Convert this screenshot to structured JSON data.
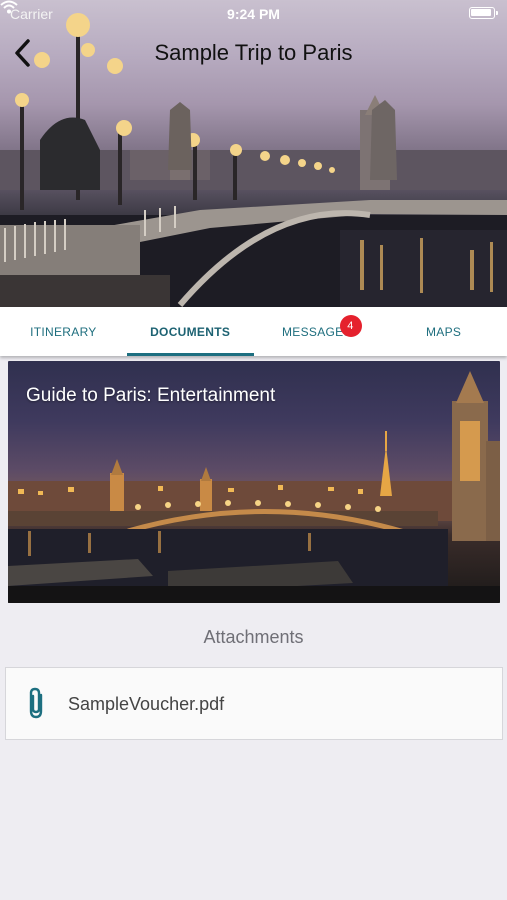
{
  "status_bar": {
    "carrier": "Carrier",
    "time": "9:24 PM"
  },
  "header": {
    "title": "Sample Trip to Paris",
    "back_icon": "chevron-left-icon"
  },
  "tabs": [
    {
      "label": "ITINERARY",
      "active": false
    },
    {
      "label": "DOCUMENTS",
      "active": true
    },
    {
      "label": "MESSAGES",
      "active": false,
      "badge": "4"
    },
    {
      "label": "MAPS",
      "active": false
    }
  ],
  "document": {
    "title": "Guide to Paris: Entertainment"
  },
  "attachments": {
    "heading": "Attachments",
    "items": [
      {
        "name": "SampleVoucher.pdf",
        "icon": "paperclip-icon"
      }
    ]
  },
  "colors": {
    "accent": "#1d6f80",
    "badge": "#e5212d",
    "background": "#eeedf2"
  }
}
